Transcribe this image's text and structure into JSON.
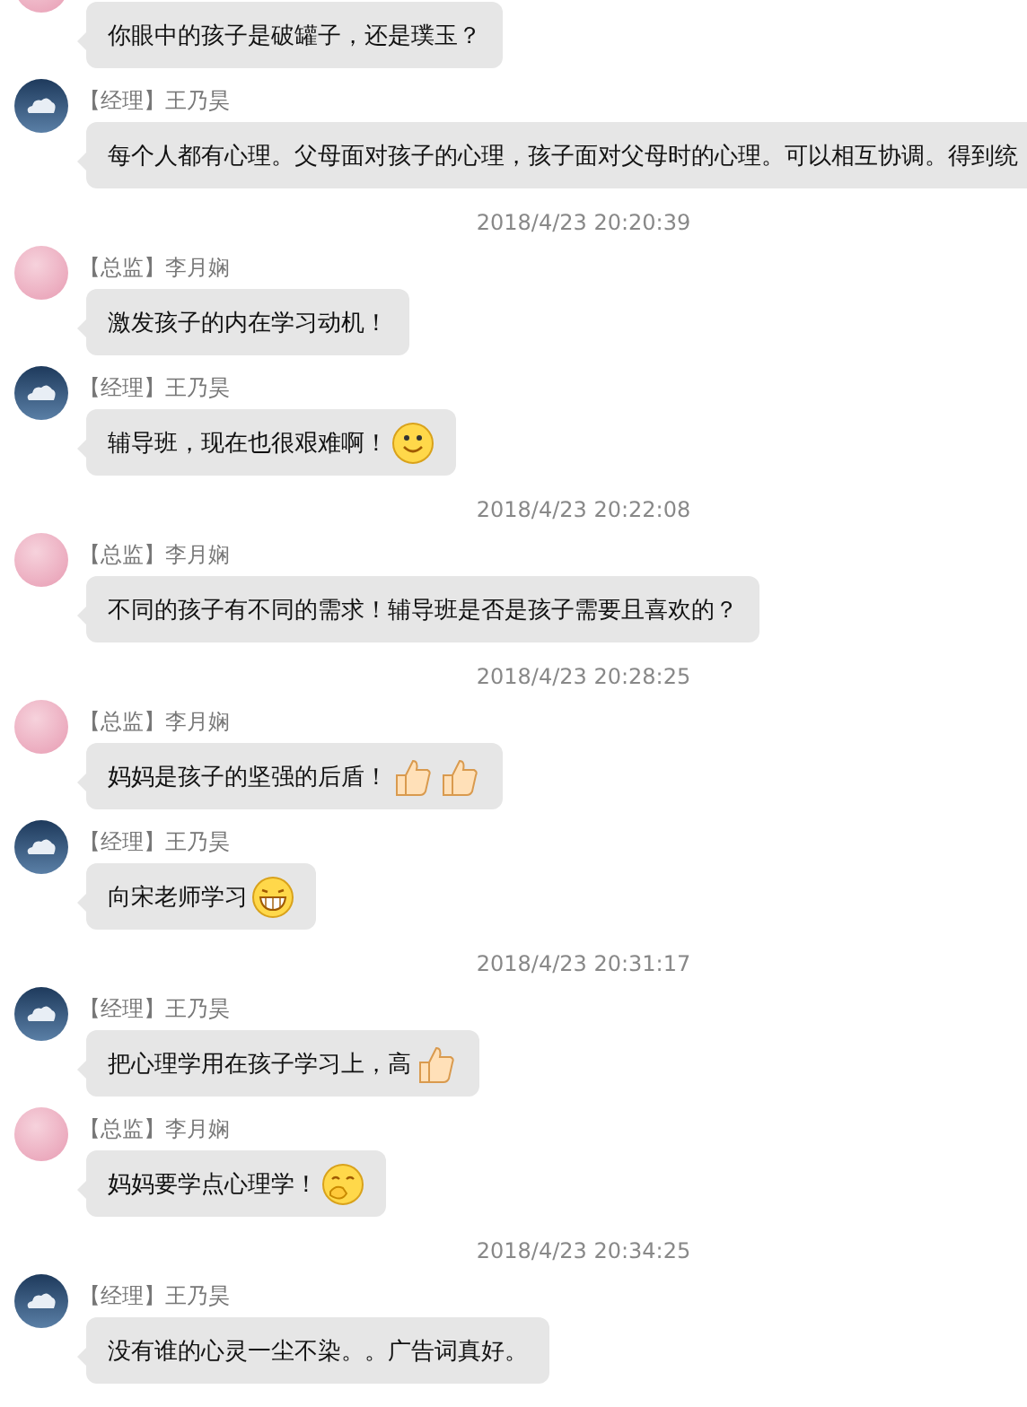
{
  "items": [
    {
      "kind": "message",
      "avatar": {
        "kind": "photo"
      },
      "text": "你眼中的孩子是破罐子，还是璞玉？"
    },
    {
      "kind": "message",
      "avatar": {
        "kind": "cloud"
      },
      "sender": "【经理】王乃昊",
      "text": "每个人都有心理。父母面对孩子的心理，孩子面对父母时的心理。可以相互协调。得到统"
    },
    {
      "kind": "time",
      "text": "2018/4/23 20:20:39"
    },
    {
      "kind": "message",
      "avatar": {
        "kind": "photo"
      },
      "sender": "【总监】李月娴",
      "text": "激发孩子的内在学习动机！"
    },
    {
      "kind": "message",
      "avatar": {
        "kind": "cloud"
      },
      "sender": "【经理】王乃昊",
      "text": "辅导班，现在也很艰难啊！",
      "emojis": [
        {
          "kind": "smile"
        }
      ]
    },
    {
      "kind": "time",
      "text": "2018/4/23 20:22:08"
    },
    {
      "kind": "message",
      "avatar": {
        "kind": "photo"
      },
      "sender": "【总监】李月娴",
      "text": "不同的孩子有不同的需求！辅导班是否是孩子需要且喜欢的？"
    },
    {
      "kind": "time",
      "text": "2018/4/23 20:28:25"
    },
    {
      "kind": "message",
      "avatar": {
        "kind": "photo"
      },
      "sender": "【总监】李月娴",
      "text": "妈妈是孩子的坚强的后盾！",
      "emojis": [
        {
          "kind": "thumb"
        },
        {
          "kind": "thumb"
        }
      ]
    },
    {
      "kind": "message",
      "avatar": {
        "kind": "cloud"
      },
      "sender": "【经理】王乃昊",
      "text": "向宋老师学习",
      "emojis": [
        {
          "kind": "grin"
        }
      ]
    },
    {
      "kind": "time",
      "text": "2018/4/23 20:31:17"
    },
    {
      "kind": "message",
      "avatar": {
        "kind": "cloud"
      },
      "sender": "【经理】王乃昊",
      "text": "把心理学用在孩子学习上，高",
      "emojis": [
        {
          "kind": "thumb"
        }
      ]
    },
    {
      "kind": "message",
      "avatar": {
        "kind": "photo"
      },
      "sender": "【总监】李月娴",
      "text": "妈妈要学点心理学！",
      "emojis": [
        {
          "kind": "think"
        }
      ]
    },
    {
      "kind": "time",
      "text": "2018/4/23 20:34:25"
    },
    {
      "kind": "message",
      "avatar": {
        "kind": "cloud"
      },
      "sender": "【经理】王乃昊",
      "text": "没有谁的心灵一尘不染。。广告词真好。"
    }
  ]
}
